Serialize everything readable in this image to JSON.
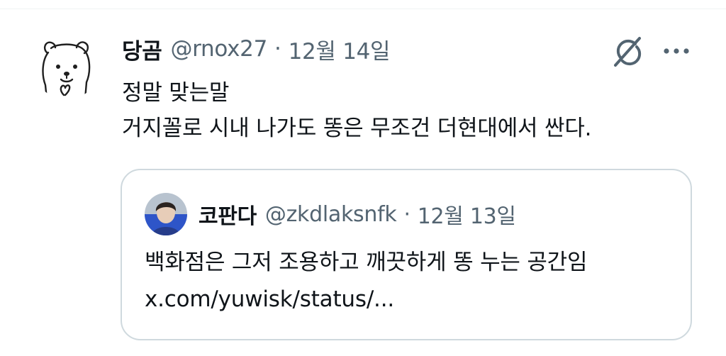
{
  "post": {
    "author_name": "당곰",
    "author_handle": "@rnox27",
    "separator": "·",
    "date": "12월 14일",
    "text_line1": "정말 맞는말",
    "text_line2": "거지꼴로 시내 나가도 똥은 무조건 더현대에서 싼다.",
    "avatar_icon": "polar-bear-icon",
    "grok_icon": "grok-icon",
    "more_icon": "more-dots-icon"
  },
  "quote": {
    "author_name": "코판다",
    "author_handle": "@zkdlaksnfk",
    "separator": "·",
    "date": "12월 13일",
    "text": "백화점은 그저 조용하고 깨끗하게 똥 누는 공간임",
    "link_text": "x.com/yuwisk/status/..."
  },
  "colors": {
    "text_primary": "#0f1419",
    "text_secondary": "#536471",
    "border": "#cfd9de"
  }
}
